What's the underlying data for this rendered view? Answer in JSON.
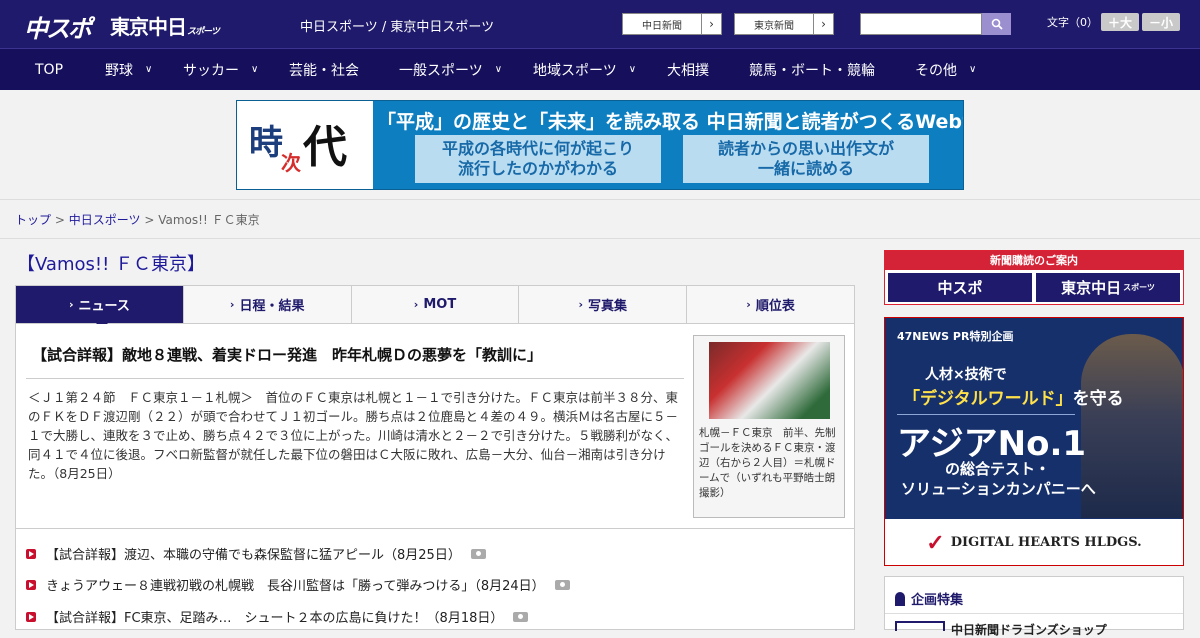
{
  "header": {
    "logo_chusupo": "中スポ",
    "logo_tokyo": "東京中日",
    "logo_tokyo_small": "スポーツ",
    "site_title": "中日スポーツ / 東京中日スポーツ",
    "link_chunichi": "中日新聞",
    "link_tokyo": "東京新聞",
    "search_placeholder": "",
    "font_size_label": "文字（0）",
    "font_plus": "＋大",
    "font_minus": "－小"
  },
  "nav": {
    "items": [
      "TOP",
      "野球",
      "サッカー",
      "芸能・社会",
      "一般スポーツ",
      "地域スポーツ",
      "大相撲",
      "競馬・ボート・競輪",
      "その他"
    ]
  },
  "banner": {
    "logo_ji": "時",
    "logo_ji2": "次",
    "logo_dai": "代",
    "headline": "「平成」の歴史と「未来」を読み取る  中日新聞と読者がつくるWebサイト",
    "box1_line1": "平成の各時代に何が起こり",
    "box1_line2": "流行したのかがわかる",
    "box2_line1": "読者からの思い出作文が",
    "box2_line2": "一緒に読める"
  },
  "breadcrumb": {
    "top": "トップ",
    "section": "中日スポーツ",
    "current": "Vamos!!  ＦＣ東京",
    "sep": ">"
  },
  "page_title": "【Vamos!!  ＦＣ東京】",
  "tabs": [
    "ニュース",
    "日程・結果",
    "MOT",
    "写真集",
    "順位表"
  ],
  "article": {
    "title": "【試合詳報】敵地８連戦、着実ドロー発進　昨年札幌Ｄの悪夢を「教訓に」",
    "body": "＜Ｊ１第２４節　ＦＣ東京１－１札幌＞　首位のＦＣ東京は札幌と１－１で引き分けた。ＦＣ東京は前半３８分、東のＦＫをＤＦ渡辺剛（２２）が頭で合わせてＪ１初ゴール。勝ち点は２位鹿島と４差の４９。横浜Ｍは名古屋に５－１で大勝し、連敗を３で止め、勝ち点４２で３位に上がった。川崎は清水と２－２で引き分けた。５戦勝利がなく、同４１で４位に後退。フベロ新監督が就任した最下位の磐田はＣ大阪に敗れ、広島－大分、仙台－湘南は引き分けた。（8月25日）",
    "photo_caption": "札幌－ＦＣ東京　前半、先制ゴールを決めるＦＣ東京・渡辺（右から２人目）＝札幌ドームで（いずれも平野皓士朗撮影）"
  },
  "news": [
    "【試合詳報】渡辺、本職の守備でも森保監督に猛アピール（8月25日）",
    "きょうアウェー８連戦初戦の札幌戦　長谷川監督は「勝って弾みつける」（8月24日）",
    "【試合詳報】FC東京、足踏み…　シュート２本の広島に負けた！（8月18日）"
  ],
  "sidebar": {
    "subscribe_head": "新聞購読のご案内",
    "sub_logo1": "中スポ",
    "sub_logo2": "東京中日",
    "sub_logo2_small": "スポーツ",
    "ad_tag": "47NEWS PR特別企画",
    "ad_line1": "人材×技術で",
    "ad_line2_hl": "「デジタルワールド」",
    "ad_line2_rest": "を守る",
    "ad_asia": "アジアNo.1",
    "ad_line3": "の総合テスト・",
    "ad_line4": "ソリューションカンパニーへ",
    "ad_company": "DIGITAL HEARTS HLDGS.",
    "feature_title": "企画特集",
    "feature_item": "中日新聞ドラゴンズショップ"
  },
  "colors": {
    "header_bg": "#1f1a6b",
    "accent_red": "#c8102e",
    "link": "#1f1a9a"
  }
}
